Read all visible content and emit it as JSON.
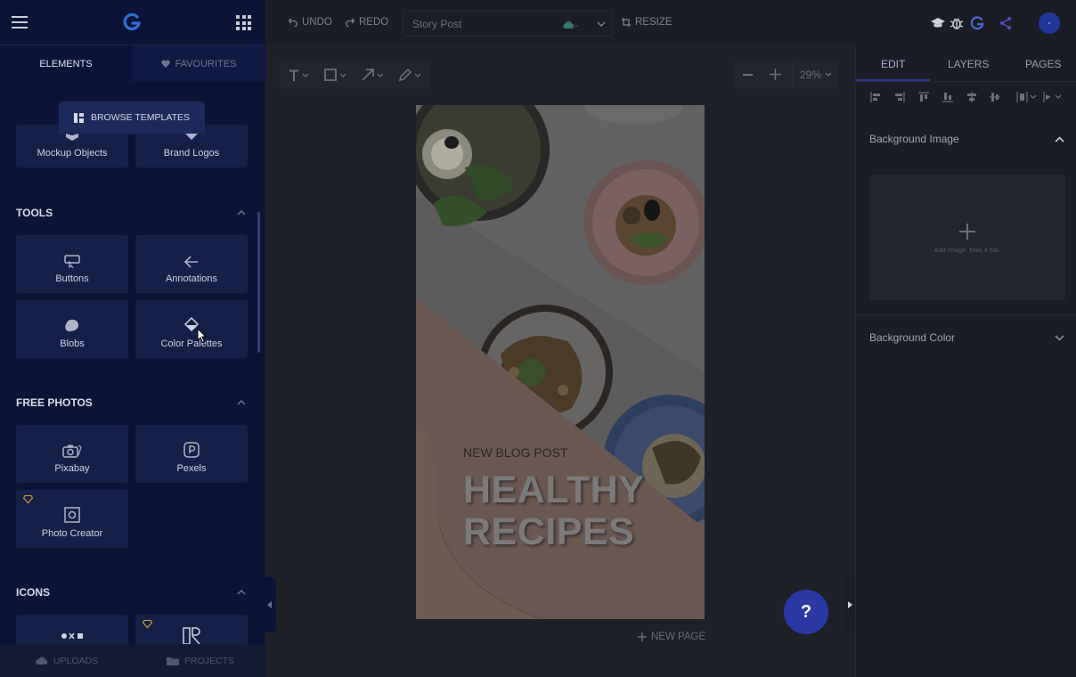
{
  "sidebar": {
    "tabs": {
      "elements": "ELEMENTS",
      "favourites": "FAVOURITES"
    },
    "browse_templates": "BROWSE TEMPLATES",
    "top_cards": [
      {
        "label": "Mockup Objects"
      },
      {
        "label": "Brand Logos"
      }
    ],
    "tools": {
      "title": "TOOLS",
      "items": [
        {
          "label": "Buttons"
        },
        {
          "label": "Annotations"
        },
        {
          "label": "Blobs"
        },
        {
          "label": "Color Palettes"
        }
      ]
    },
    "free_photos": {
      "title": "FREE PHOTOS",
      "items": [
        {
          "label": "Pixabay"
        },
        {
          "label": "Pexels"
        },
        {
          "label": "Photo Creator"
        }
      ]
    },
    "icons": {
      "title": "ICONS"
    },
    "bottom": {
      "uploads": "UPLOADS",
      "projects": "PROJECTS"
    }
  },
  "toolbar": {
    "undo": "UNDO",
    "redo": "REDO",
    "doc_name": "Story Post",
    "resize": "RESIZE"
  },
  "workspace": {
    "zoom": "29%",
    "new_page": "NEW PAGE",
    "help": "?"
  },
  "canvas_text": {
    "eyebrow": "NEW BLOG POST",
    "headline_1": "HEALTHY",
    "headline_2": "RECIPES"
  },
  "right_panel": {
    "tabs": {
      "edit": "EDIT",
      "layers": "LAYERS",
      "pages": "PAGES"
    },
    "background_image": "Background Image",
    "add_image_hint": "Add image. Max 4 Mb.",
    "background_color": "Background Color"
  },
  "colors": {
    "sidebar_bg": "#0b1437",
    "accent": "#2b39a5",
    "canvas_pink": "#dcb6a9",
    "logo_blue": "#2f6fd6"
  }
}
